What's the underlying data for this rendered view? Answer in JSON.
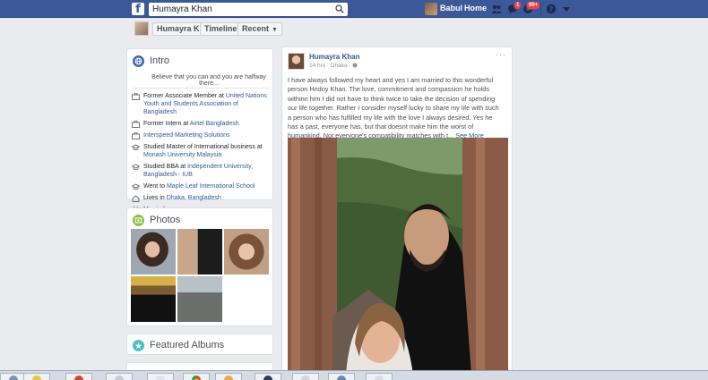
{
  "topbar": {
    "brand_letter": "f",
    "search_value": "Humayra Khan",
    "user_name": "Babul",
    "home_label": "Home",
    "messages_badge": "1",
    "notifications_badge": "99+"
  },
  "profile_strip": {
    "name": "Humayra Khan",
    "timeline_label": "Timeline",
    "recent_label": "Recent"
  },
  "intro": {
    "title": "Intro",
    "quote": "Believe that you can and you are halfway there...",
    "items": [
      {
        "icon": "briefcase-icon",
        "pre": "Former Associate Member at ",
        "link": "United Nations Youth and Students Association of Bangladesh"
      },
      {
        "icon": "briefcase-icon",
        "pre": "Former Intern at ",
        "link": "Airtel Bangladesh"
      },
      {
        "icon": "briefcase-icon",
        "pre": "",
        "link": "Interspeed Marketing Solutions"
      },
      {
        "icon": "graduation-cap-icon",
        "pre": "Studied Master of International business at ",
        "link": "Monash University Malaysia"
      },
      {
        "icon": "graduation-cap-icon",
        "pre": "Studied BBA at ",
        "link": "Independent University, Bangladesh - IUB"
      },
      {
        "icon": "graduation-cap-icon",
        "pre": "Went to ",
        "link": "Maple Leaf International School"
      },
      {
        "icon": "home-icon",
        "pre": "Lives in ",
        "link": "Dhaka, Bangladesh"
      },
      {
        "icon": "heart-icon",
        "pre": "Married",
        "link": ""
      }
    ]
  },
  "photos": {
    "title": "Photos"
  },
  "albums": {
    "title": "Featured Albums"
  },
  "post": {
    "author": "Humayra Khan",
    "meta": "14 hrs · Dhaka · ",
    "more": "···",
    "text": "I have always followed my heart and yes I am married to this wonderful person Hridoy Khan. The love, commitment and compassion he holds withinn him I did not have to think twice to take the decision of spending our life together. Rather I consider myself lucky to share my life with such a person who has fulfilled my life with the love I always desired. Yes he has a past, everyone has, but that doesnt make him the worst of humankind. Not everyone's compatibility matches with t... ",
    "see_more": "See More"
  },
  "colors": {
    "brand": "#3b5998",
    "link": "#365899",
    "page_bg": "#e9ebee",
    "badge": "#fa3e3e"
  }
}
